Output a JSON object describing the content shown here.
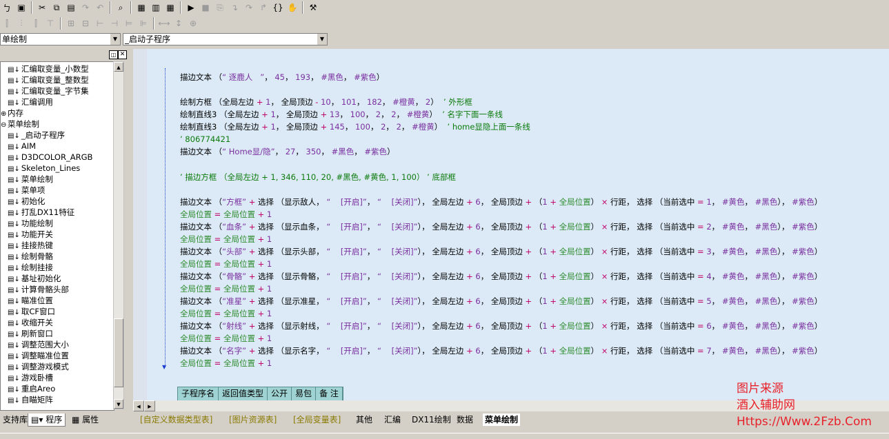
{
  "combos": {
    "left": "单绘制",
    "right": "_启动子程序"
  },
  "tree_items": [
    {
      "text": "汇编取变量_小数型",
      "indent": 2
    },
    {
      "text": "汇编取变量_整数型",
      "indent": 2
    },
    {
      "text": "汇编取变量_字节集",
      "indent": 2
    },
    {
      "text": "汇编调用",
      "indent": 2
    },
    {
      "text": "内存",
      "indent": 0,
      "expander": "⊕"
    },
    {
      "text": "菜单绘制",
      "indent": 0,
      "expander": "⊖"
    },
    {
      "text": "_启动子程序",
      "indent": 2
    },
    {
      "text": "AIM",
      "indent": 2
    },
    {
      "text": "D3DCOLOR_ARGB",
      "indent": 2
    },
    {
      "text": "Skeleton_Lines",
      "indent": 2
    },
    {
      "text": "菜单绘制",
      "indent": 2
    },
    {
      "text": "菜单项",
      "indent": 2
    },
    {
      "text": "初始化",
      "indent": 2
    },
    {
      "text": "打乱DX11特征",
      "indent": 2
    },
    {
      "text": "功能绘制",
      "indent": 2
    },
    {
      "text": "功能开关",
      "indent": 2
    },
    {
      "text": "挂接热键",
      "indent": 2
    },
    {
      "text": "绘制骨骼",
      "indent": 2
    },
    {
      "text": "绘制挂接",
      "indent": 2
    },
    {
      "text": "基址初始化",
      "indent": 2
    },
    {
      "text": "计算骨骼头部",
      "indent": 2
    },
    {
      "text": "瞄准位置",
      "indent": 2
    },
    {
      "text": "取CF窗口",
      "indent": 2
    },
    {
      "text": "收缩开关",
      "indent": 2
    },
    {
      "text": "刷新窗口",
      "indent": 2
    },
    {
      "text": "调整范围大小",
      "indent": 2
    },
    {
      "text": "调整瞄准位置",
      "indent": 2
    },
    {
      "text": "调整游戏模式",
      "indent": 2
    },
    {
      "text": "游戏卧槽",
      "indent": 2
    },
    {
      "text": "重启Areo",
      "indent": 2
    },
    {
      "text": "自瞄矩阵",
      "indent": 2
    }
  ],
  "left_tabs": [
    "支持库",
    "程序",
    "属性"
  ],
  "code": {
    "line1": [
      [
        "kw",
        "描边文本 （"
      ],
      [
        "str",
        "“ 逐鹿人   ”"
      ],
      [
        "kw",
        "， "
      ],
      [
        "num",
        "45"
      ],
      [
        "kw",
        "， "
      ],
      [
        "num",
        "193"
      ],
      [
        "kw",
        "， "
      ],
      [
        "num",
        "#黑色"
      ],
      [
        "kw",
        "， "
      ],
      [
        "num",
        "#紫色"
      ],
      [
        "kw",
        "）"
      ]
    ],
    "line2": [
      [
        "kw",
        "绘制方框 （全局左边 "
      ],
      [
        "op",
        "+"
      ],
      [
        "kw",
        " "
      ],
      [
        "num",
        "1"
      ],
      [
        "kw",
        "， 全局顶边 "
      ],
      [
        "op",
        "-"
      ],
      [
        "kw",
        " "
      ],
      [
        "num",
        "10"
      ],
      [
        "kw",
        "， "
      ],
      [
        "num",
        "101"
      ],
      [
        "kw",
        "， "
      ],
      [
        "num",
        "182"
      ],
      [
        "kw",
        "， "
      ],
      [
        "num",
        "#橙黄"
      ],
      [
        "kw",
        "， "
      ],
      [
        "num",
        "2"
      ],
      [
        "kw",
        "）  "
      ],
      [
        "cm",
        "’ 外形框"
      ]
    ],
    "line3": [
      [
        "kw",
        "绘制直线3 （全局左边 "
      ],
      [
        "op",
        "+"
      ],
      [
        "kw",
        " "
      ],
      [
        "num",
        "1"
      ],
      [
        "kw",
        "， 全局顶边 "
      ],
      [
        "op",
        "+"
      ],
      [
        "kw",
        " "
      ],
      [
        "num",
        "13"
      ],
      [
        "kw",
        "， "
      ],
      [
        "num",
        "100"
      ],
      [
        "kw",
        "， "
      ],
      [
        "num",
        "2"
      ],
      [
        "kw",
        "， "
      ],
      [
        "num",
        "2"
      ],
      [
        "kw",
        "， "
      ],
      [
        "num",
        "#橙黄"
      ],
      [
        "kw",
        "）  "
      ],
      [
        "cm",
        "’ 名字下面一条线"
      ]
    ],
    "line4": [
      [
        "kw",
        "绘制直线3 （全局左边 "
      ],
      [
        "op",
        "+"
      ],
      [
        "kw",
        " "
      ],
      [
        "num",
        "1"
      ],
      [
        "kw",
        "， 全局顶边 "
      ],
      [
        "op",
        "+"
      ],
      [
        "kw",
        " "
      ],
      [
        "num",
        "145"
      ],
      [
        "kw",
        "， "
      ],
      [
        "num",
        "100"
      ],
      [
        "kw",
        "， "
      ],
      [
        "num",
        "2"
      ],
      [
        "kw",
        "， "
      ],
      [
        "num",
        "2"
      ],
      [
        "kw",
        "， "
      ],
      [
        "num",
        "#橙黄"
      ],
      [
        "kw",
        "）  "
      ],
      [
        "cm",
        "’ home显隐上面一条线"
      ]
    ],
    "line5": [
      [
        "cm",
        "’ 806774421"
      ]
    ],
    "line6": [
      [
        "kw",
        "描边文本 （"
      ],
      [
        "str",
        "“ Home显/隐”"
      ],
      [
        "kw",
        "， "
      ],
      [
        "num",
        "27"
      ],
      [
        "kw",
        "， "
      ],
      [
        "num",
        "350"
      ],
      [
        "kw",
        "， "
      ],
      [
        "num",
        "#黑色"
      ],
      [
        "kw",
        "， "
      ],
      [
        "num",
        "#紫色"
      ],
      [
        "kw",
        "）"
      ]
    ],
    "line7": [
      [
        "cm",
        "’ 描边方框 （全局左边 + 1, 346, 110, 20, #黑色, #黄色, 1, 100） ’ 底部框"
      ]
    ]
  },
  "menu_rows": [
    {
      "label": "“方框”",
      "show": "显示敌人",
      "sel": "1"
    },
    {
      "label": "“血条”",
      "show": "显示血条",
      "sel": "2"
    },
    {
      "label": "“头部”",
      "show": "显示头部",
      "sel": "3"
    },
    {
      "label": "“骨骼”",
      "show": "显示骨骼",
      "sel": "4"
    },
    {
      "label": "“准星”",
      "show": "显示准星",
      "sel": "5"
    },
    {
      "label": "“射线”",
      "show": "显示射线",
      "sel": "6"
    },
    {
      "label": "“名字”",
      "show": "显示名字",
      "sel": "7"
    }
  ],
  "menu_row_text": {
    "draw": "描边文本 （",
    "select": "选择 （",
    "on": "“    [开启]”",
    "off": "“    [关闭]”",
    "left": "全局左边",
    "six": "6",
    "top": "全局顶边",
    "one": "1",
    "pos": "全局位置",
    "mul": "×",
    "rowgap": "行距",
    "cur": "当前选中",
    "yellow": "#黄色",
    "black": "#黑色",
    "purple": "#紫色"
  },
  "table_header": [
    "子程序名",
    "返回值类型",
    "公开",
    "易包",
    "备 注"
  ],
  "file_tabs": [
    "[自定义数据类型表]",
    "[图片资源表]",
    "[全局变量表]",
    "其他",
    "汇编",
    "DX11绘制",
    "数据",
    "菜单绘制"
  ],
  "watermark": [
    "图片来源",
    "酒入辅助网",
    "Https://Www.2Fzb.Com"
  ],
  "colors": {
    "editor_bg": "#dbeaf6",
    "keyword_green": "#2e8b2e",
    "string_purple": "#7a2fa0",
    "operator": "#c0006a",
    "watermark": "#e8202a"
  }
}
